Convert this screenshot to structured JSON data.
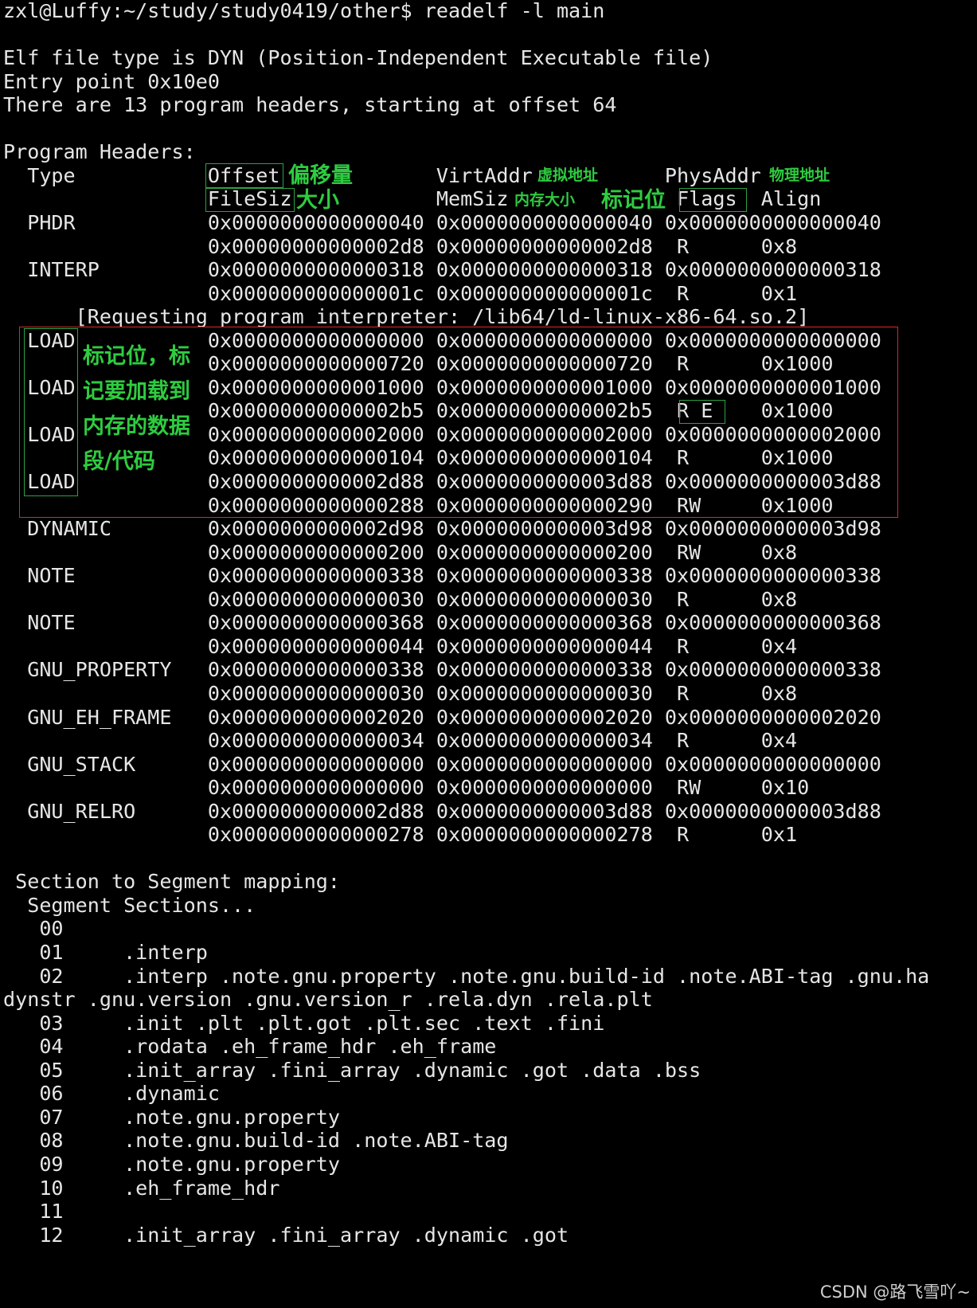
{
  "terminal": {
    "lines": [
      "zxl@Luffy:~/study/study0419/other$ readelf -l main",
      "",
      "Elf file type is DYN (Position-Independent Executable file)",
      "Entry point 0x10e0",
      "There are 13 program headers, starting at offset 64",
      "",
      "Program Headers:",
      "  Type           Offset             VirtAddr           PhysAddr",
      "                 FileSiz            MemSiz              Flags  Align",
      "  PHDR           0x0000000000000040 0x0000000000000040 0x0000000000000040",
      "                 0x00000000000002d8 0x00000000000002d8  R      0x8",
      "  INTERP         0x0000000000000318 0x0000000000000318 0x0000000000000318",
      "                 0x000000000000001c 0x000000000000001c  R      0x1",
      "      [Requesting program interpreter: /lib64/ld-linux-x86-64.so.2]",
      "  LOAD           0x0000000000000000 0x0000000000000000 0x0000000000000000",
      "                 0x0000000000000720 0x0000000000000720  R      0x1000",
      "  LOAD           0x0000000000001000 0x0000000000001000 0x0000000000001000",
      "                 0x00000000000002b5 0x00000000000002b5  R E    0x1000",
      "  LOAD           0x0000000000002000 0x0000000000002000 0x0000000000002000",
      "                 0x0000000000000104 0x0000000000000104  R      0x1000",
      "  LOAD           0x0000000000002d88 0x0000000000003d88 0x0000000000003d88",
      "                 0x0000000000000288 0x0000000000000290  RW     0x1000",
      "  DYNAMIC        0x0000000000002d98 0x0000000000003d98 0x0000000000003d98",
      "                 0x0000000000000200 0x0000000000000200  RW     0x8",
      "  NOTE           0x0000000000000338 0x0000000000000338 0x0000000000000338",
      "                 0x0000000000000030 0x0000000000000030  R      0x8",
      "  NOTE           0x0000000000000368 0x0000000000000368 0x0000000000000368",
      "                 0x0000000000000044 0x0000000000000044  R      0x4",
      "  GNU_PROPERTY   0x0000000000000338 0x0000000000000338 0x0000000000000338",
      "                 0x0000000000000030 0x0000000000000030  R      0x8",
      "  GNU_EH_FRAME   0x0000000000002020 0x0000000000002020 0x0000000000002020",
      "                 0x0000000000000034 0x0000000000000034  R      0x4",
      "  GNU_STACK      0x0000000000000000 0x0000000000000000 0x0000000000000000",
      "                 0x0000000000000000 0x0000000000000000  RW     0x10",
      "  GNU_RELRO      0x0000000000002d88 0x0000000000003d88 0x0000000000003d88",
      "                 0x0000000000000278 0x0000000000000278  R      0x1",
      "",
      " Section to Segment mapping:",
      "  Segment Sections...",
      "   00",
      "   01     .interp",
      "   02     .interp .note.gnu.property .note.gnu.build-id .note.ABI-tag .gnu.ha",
      "dynstr .gnu.version .gnu.version_r .rela.dyn .rela.plt",
      "   03     .init .plt .plt.got .plt.sec .text .fini",
      "   04     .rodata .eh_frame_hdr .eh_frame",
      "   05     .init_array .fini_array .dynamic .got .data .bss",
      "   06     .dynamic",
      "   07     .note.gnu.property",
      "   08     .note.gnu.build-id .note.ABI-tag",
      "   09     .note.gnu.property",
      "   10     .eh_frame_hdr",
      "   11",
      "   12     .init_array .fini_array .dynamic .got"
    ]
  },
  "annotations": {
    "offset": "偏移量",
    "filesiz": "大小",
    "virtaddr": "虚拟地址",
    "memsiz": "内存大小",
    "flags": "标记位",
    "physaddr": "物理地址",
    "load_note_1": "标记位，标",
    "load_note_2": "记要加载到",
    "load_note_3": "内存的数据",
    "load_note_4": "段/代码"
  },
  "watermark": "CSDN @路飞雪吖~",
  "colors": {
    "background": "#000000",
    "text": "#e6e6e6",
    "annotation": "#2ecc40",
    "box_green": "#2ea043",
    "box_red": "#d8282f"
  }
}
